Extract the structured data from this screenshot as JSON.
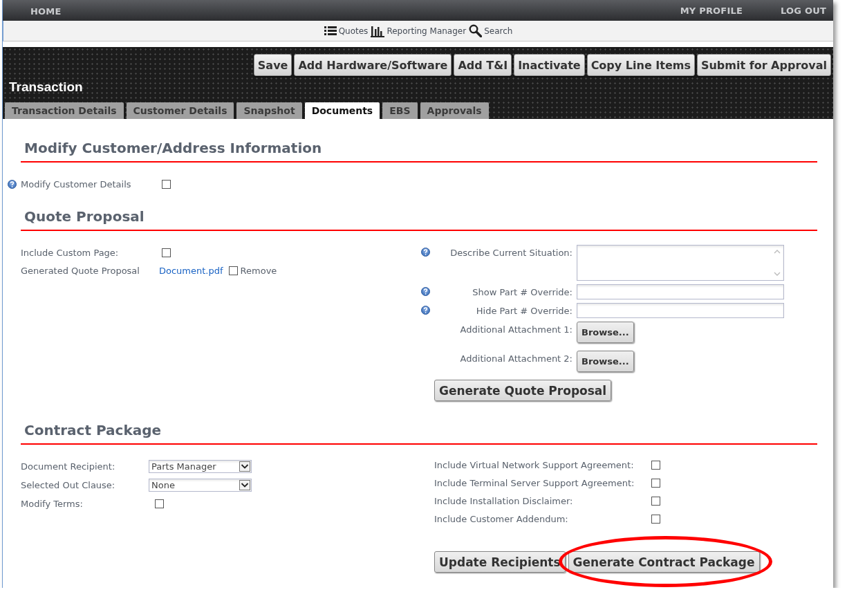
{
  "top_nav": {
    "left": [
      "HOME"
    ],
    "right": [
      "MY PROFILE",
      "LOG OUT"
    ]
  },
  "sub_nav": [
    {
      "label": "Quotes"
    },
    {
      "label": "Reporting Manager"
    },
    {
      "label": "Search"
    }
  ],
  "header": {
    "title": "Transaction",
    "buttons": [
      "Save",
      "Add Hardware/Software",
      "Add T&I",
      "Inactivate",
      "Copy Line Items",
      "Submit for Approval"
    ]
  },
  "tabs": [
    {
      "label": "Transaction Details",
      "selected": false
    },
    {
      "label": "Customer Details",
      "selected": false
    },
    {
      "label": "Snapshot",
      "selected": false
    },
    {
      "label": "Documents",
      "selected": true
    },
    {
      "label": "EBS",
      "selected": false
    },
    {
      "label": "Approvals",
      "selected": false
    }
  ],
  "modify_section": {
    "title": "Modify Customer/Address Information",
    "fields": [
      {
        "label": "Modify Customer Details",
        "help": true,
        "checked": false
      }
    ]
  },
  "quote_proposal": {
    "title": "Quote Proposal",
    "left": [
      {
        "kind": "checkbox",
        "label": "Include Custom Page:",
        "checked": false
      },
      {
        "kind": "document",
        "label": "Generated Quote Proposal",
        "link": "Document.pdf",
        "remove_checked": false,
        "remove_label": "Remove"
      }
    ],
    "right": [
      {
        "kind": "textarea",
        "label": "Describe Current Situation:",
        "help": true
      },
      {
        "kind": "text",
        "label": "Show Part # Override:",
        "help": true
      },
      {
        "kind": "text",
        "label": "Hide Part # Override:",
        "help": true
      },
      {
        "kind": "file",
        "label": "Additional Attachment 1:",
        "help": false,
        "button": "Browse..."
      },
      {
        "kind": "file",
        "label": "Additional Attachment 2:",
        "help": false,
        "button": "Browse..."
      }
    ],
    "button": "Generate Quote Proposal"
  },
  "contract_package": {
    "title": "Contract Package",
    "left": [
      {
        "kind": "select",
        "label": "Document Recipient:",
        "value": "Parts Manager"
      },
      {
        "kind": "select",
        "label": "Selected Out Clause:",
        "value": "None"
      },
      {
        "kind": "checkbox",
        "label": "Modify Terms:",
        "checked": false
      }
    ],
    "right": [
      {
        "label": "Include Virtual Network Support Agreement:",
        "checked": false
      },
      {
        "label": "Include Terminal Server Support Agreement:",
        "checked": false
      },
      {
        "label": "Include Installation Disclaimer:",
        "checked": false
      },
      {
        "label": "Include Customer Addendum:",
        "checked": false
      }
    ],
    "buttons": [
      {
        "label": "Update Recipients",
        "highlighted": false
      },
      {
        "label": "Generate Contract Package",
        "highlighted": true
      }
    ]
  }
}
